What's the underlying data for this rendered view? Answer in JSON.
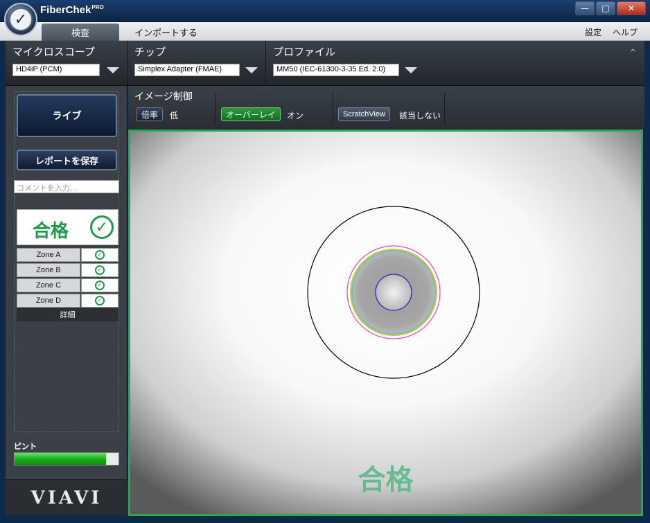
{
  "window": {
    "title": "FiberChek",
    "title_sup": "PRO",
    "controls": {
      "minimize": "—",
      "maximize": "□",
      "close": "✕"
    }
  },
  "menubar": {
    "tab_inspect": "検査",
    "tab_import": "インポートする",
    "settings": "設定",
    "help": "ヘルプ"
  },
  "device": {
    "microscope_label": "マイクロスコープ",
    "microscope_value": "HD4iP (PCM)",
    "tip_label": "チップ",
    "tip_value": "Simplex Adapter (FMAE)",
    "profile_label": "プロファイル",
    "profile_value": "MM50 (IEC-61300-3-35 Ed. 2.0)",
    "collapse_glyph": "^"
  },
  "left": {
    "live_button": "ライブ",
    "save_report_button": "レポートを保存",
    "comment_placeholder": "コメントを入力...",
    "result_text": "合格",
    "zones": [
      {
        "name": "Zone A",
        "status": "pass"
      },
      {
        "name": "Zone B",
        "status": "pass"
      },
      {
        "name": "Zone C",
        "status": "pass"
      },
      {
        "name": "Zone D",
        "status": "pass"
      }
    ],
    "details": "詳細",
    "focus_label": "ピント",
    "focus_level": 0.88,
    "brand": "VIAVI"
  },
  "image_control": {
    "title": "イメージ制御",
    "magnification_button": "倍率",
    "magnification_value": "低",
    "overlay_button": "オーバーレイ",
    "overlay_value": "オン",
    "scratchview_button": "ScratchView",
    "scratchview_value": "該当しない"
  },
  "viewer": {
    "result_overlay": "合格",
    "accent_green": "#2aa84a"
  }
}
